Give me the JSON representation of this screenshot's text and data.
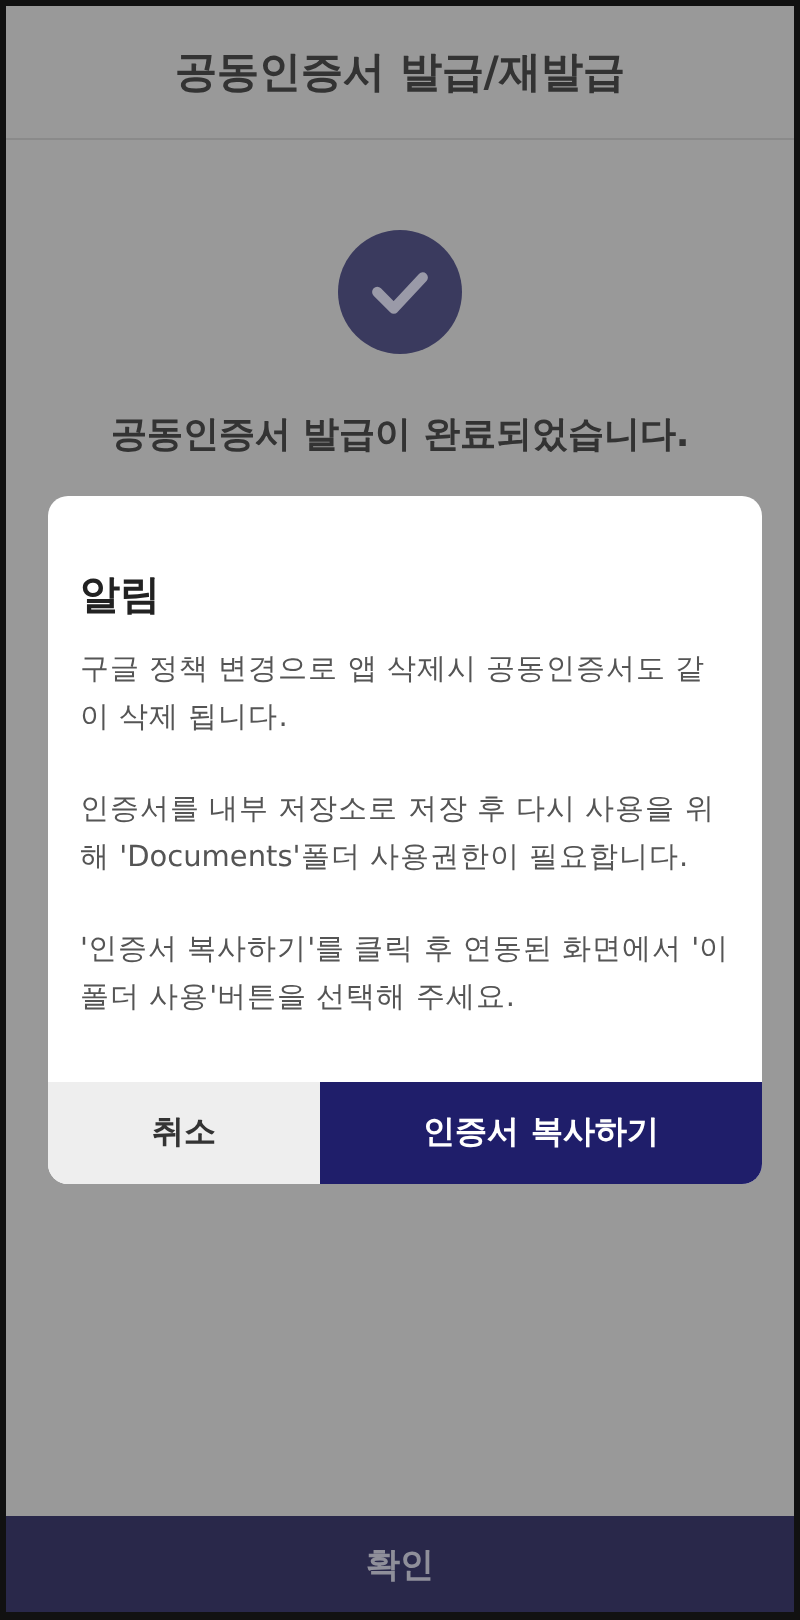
{
  "header": {
    "title": "공동인증서 발급/재발급"
  },
  "result": {
    "message": "공동인증서 발급이 완료되었습니다."
  },
  "dialog": {
    "title": "알림",
    "paragraphs": [
      "구글 정책 변경으로 앱 삭제시 공동인증서도 같이 삭제 됩니다.",
      "인증서를 내부 저장소로 저장 후 다시 사용을 위해 'Documents'폴더 사용권한이 필요합니다.",
      "'인증서 복사하기'를 클릭 후 연동된 화면에서 '이 폴더 사용'버튼을 선택해 주세요."
    ],
    "buttons": [
      {
        "label": "취소",
        "kind": "secondary"
      },
      {
        "label": "인증서 복사하기",
        "kind": "primary"
      }
    ]
  },
  "footer": {
    "button": "확인"
  }
}
